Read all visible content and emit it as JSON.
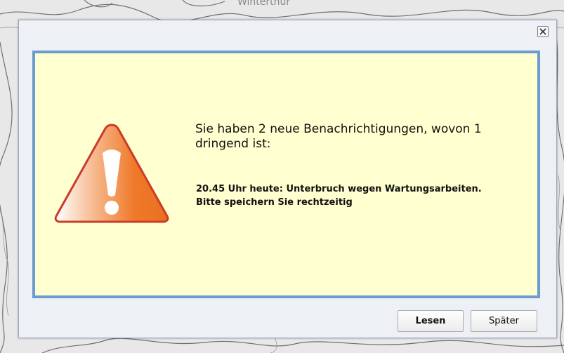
{
  "map": {
    "place_label": "Winterthur"
  },
  "dialog": {
    "close_icon": "close-icon",
    "warning_icon": "warning-triangle-icon",
    "headline": "Sie haben 2 neue Benachrichtigungen, wovon 1 dringend ist:",
    "details_line1": "20.45 Uhr heute: Unterbruch wegen Wartungsarbeiten.",
    "details_line2": "Bitte speichern Sie rechtzeitig",
    "read_button": "Lesen",
    "later_button": "Später"
  },
  "colors": {
    "panel_background": "#ffffcf",
    "panel_border": "#6a9bd1",
    "warning_orange": "#ef7a2a",
    "warning_outline": "#cc3a2a"
  }
}
